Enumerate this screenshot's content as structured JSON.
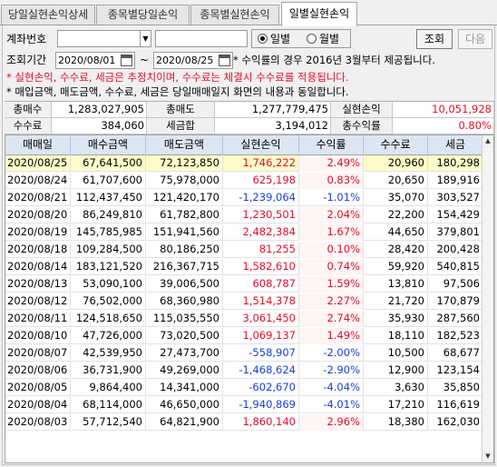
{
  "tabs": [
    "당일실현손익상세",
    "종목별당일손익",
    "종목별실현손익",
    "일별실현손익"
  ],
  "active_tab": 3,
  "form": {
    "account_label": "계좌번호",
    "period_label": "조회기간",
    "date_from": "2020/08/01",
    "date_sep": "~",
    "date_to": "2020/08/25",
    "radio_daily": "일별",
    "radio_monthly": "월별",
    "search_button": "조회",
    "next_button": "다음",
    "note": "* 수익률의 경우 2016년 3월부터 제공됩니다."
  },
  "warnings": {
    "red": "* 실현손익, 수수료, 세금은 추정치이며, 수수료는 체결시 수수료를 적용됩니다.",
    "black": "* 매입금액, 매도금액, 수수료, 세금은 당일매매일지 화면의 내용과 동일합니다."
  },
  "summary": {
    "total_buy_label": "총매수",
    "total_buy": "1,283,027,905",
    "total_sell_label": "총매도",
    "total_sell": "1,277,779,475",
    "realized_label": "실현손익",
    "realized": "10,051,928",
    "fee_label": "수수료",
    "fee": "384,060",
    "tax_label": "세금합",
    "tax": "3,194,012",
    "ret_label": "총수익률",
    "ret": "0.80%"
  },
  "table": {
    "columns": [
      "매매일",
      "매수금액",
      "매도금액",
      "실현손익",
      "수익률",
      "수수료",
      "세금"
    ],
    "rows": [
      [
        "2020/08/25",
        "67,641,500",
        "72,123,850",
        "1,746,222",
        "2.49%",
        "20,960",
        "180,298"
      ],
      [
        "2020/08/24",
        "61,707,600",
        "75,978,000",
        "625,198",
        "0.83%",
        "20,650",
        "189,916"
      ],
      [
        "2020/08/21",
        "112,437,450",
        "121,420,170",
        "-1,239,064",
        "-1.01%",
        "35,070",
        "303,527"
      ],
      [
        "2020/08/20",
        "86,249,810",
        "61,782,800",
        "1,230,501",
        "2.04%",
        "22,200",
        "154,429"
      ],
      [
        "2020/08/19",
        "145,785,985",
        "151,941,560",
        "2,482,384",
        "1.67%",
        "44,650",
        "379,801"
      ],
      [
        "2020/08/18",
        "109,284,500",
        "80,186,250",
        "81,255",
        "0.10%",
        "28,420",
        "200,428"
      ],
      [
        "2020/08/14",
        "183,121,520",
        "216,367,715",
        "1,582,610",
        "0.74%",
        "59,920",
        "540,815"
      ],
      [
        "2020/08/13",
        "53,090,100",
        "39,006,500",
        "608,787",
        "1.59%",
        "13,810",
        "97,506"
      ],
      [
        "2020/08/12",
        "76,502,000",
        "68,360,980",
        "1,514,378",
        "2.27%",
        "21,720",
        "170,879"
      ],
      [
        "2020/08/11",
        "124,518,650",
        "115,035,550",
        "3,061,450",
        "2.74%",
        "35,930",
        "287,560"
      ],
      [
        "2020/08/10",
        "47,726,000",
        "73,020,500",
        "1,069,137",
        "1.49%",
        "18,110",
        "182,523"
      ],
      [
        "2020/08/07",
        "42,539,950",
        "27,473,700",
        "-558,907",
        "-2.00%",
        "10,500",
        "68,677"
      ],
      [
        "2020/08/06",
        "36,731,900",
        "49,269,000",
        "-1,468,624",
        "-2.90%",
        "12,900",
        "123,154"
      ],
      [
        "2020/08/05",
        "9,864,400",
        "14,341,000",
        "-602,670",
        "-4.04%",
        "3,630",
        "35,850"
      ],
      [
        "2020/08/04",
        "68,114,000",
        "46,650,000",
        "-1,940,869",
        "-4.01%",
        "17,210",
        "116,619"
      ],
      [
        "2020/08/03",
        "57,712,540",
        "64,821,900",
        "1,860,140",
        "2.96%",
        "18,380",
        "162,030"
      ]
    ]
  },
  "colors": {
    "positive": "#e0102a",
    "negative": "#1a3fd6",
    "selected_row": "#fcfcc8",
    "header": "#dce6f2"
  }
}
